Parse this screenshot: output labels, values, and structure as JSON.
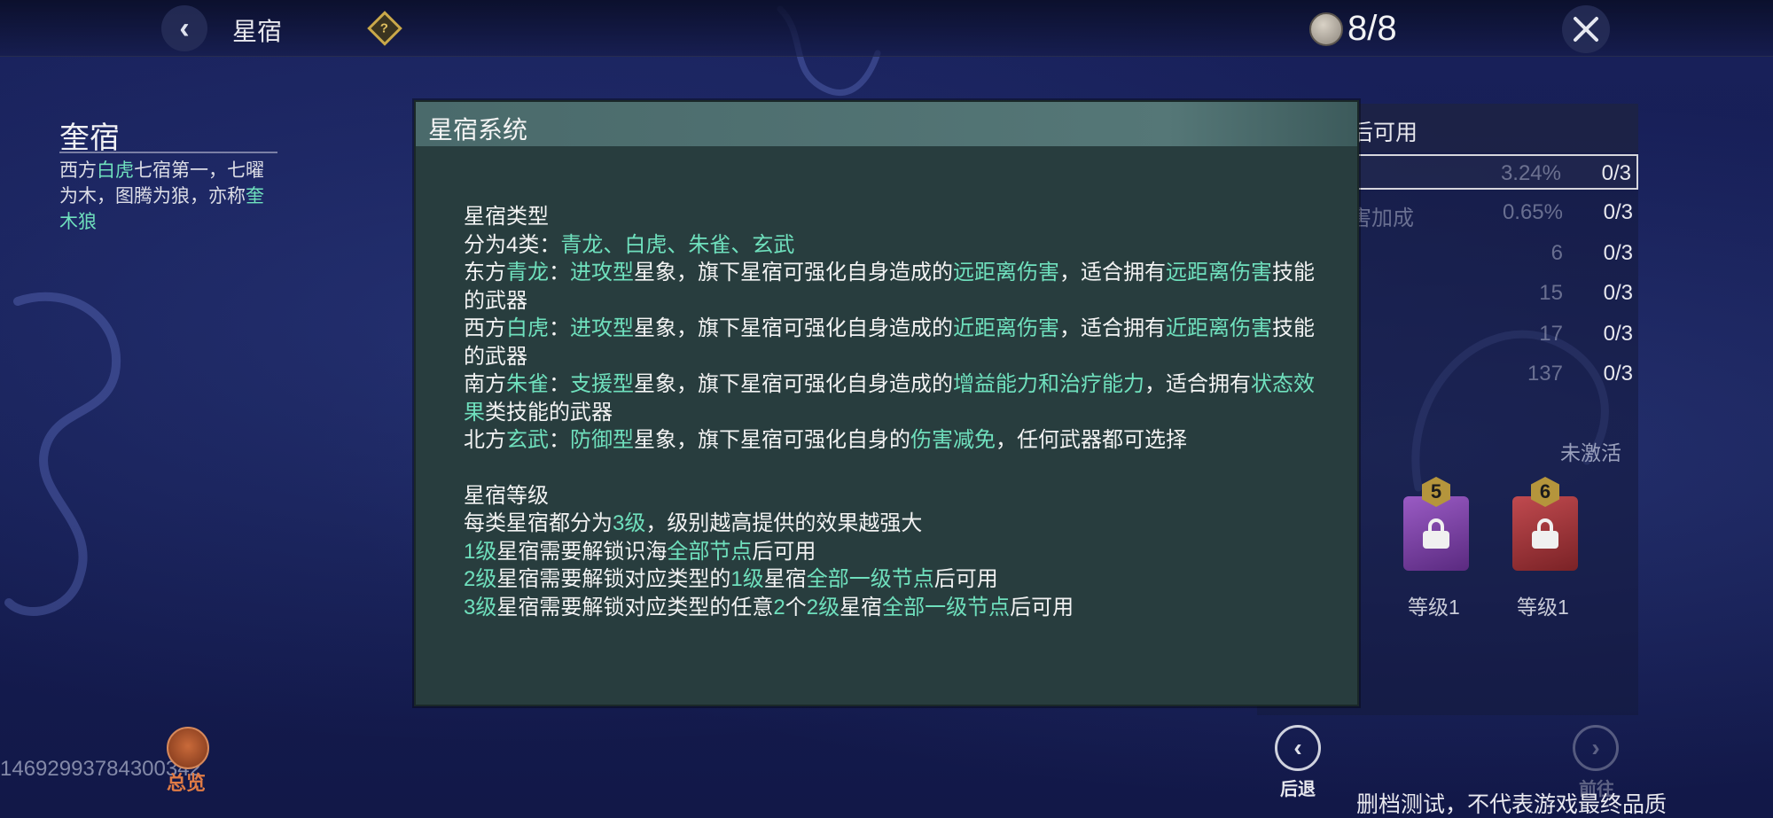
{
  "header": {
    "back_icon": "back-arrow-icon",
    "title": "星宿",
    "help_icon": "help-diamond-icon",
    "currency_icon": "star-token-icon",
    "currency_value": "8/8",
    "close_icon": "close-x-icon"
  },
  "info": {
    "name": "奎宿",
    "desc_1": "西方",
    "desc_hl_1": "白虎",
    "desc_2": "七宿第一，七曜为木，图腾为狼，亦称",
    "desc_hl_2": "奎木狼"
  },
  "footer": {
    "overview_label": "总览",
    "uid": "14692993784300342",
    "back_label": "后退",
    "forward_label": "前往",
    "note": "删档测试，不代表游戏最终品质"
  },
  "right_panel": {
    "header_text": "后可用",
    "rows": [
      {
        "label": "",
        "value": "3.24%",
        "count": "0/3"
      },
      {
        "label": "害加成",
        "value": "0.65%",
        "count": "0/3"
      },
      {
        "label": "",
        "value": "6",
        "count": "0/3"
      },
      {
        "label": "",
        "value": "15",
        "count": "0/3"
      },
      {
        "label": "",
        "value": "17",
        "count": "0/3"
      },
      {
        "label": "",
        "value": "137",
        "count": "0/3"
      }
    ],
    "inactive_label": "未激活",
    "gems": [
      {
        "badge": "5",
        "level": "等级1",
        "color": "#7a3fa0",
        "lock_icon": "lock-icon"
      },
      {
        "badge": "6",
        "level": "等级1",
        "color": "#a8363c",
        "lock_icon": "lock-icon"
      }
    ]
  },
  "modal": {
    "title": "星宿系统",
    "section1_title": "星宿类型",
    "l1": [
      "分为4类：",
      {
        "hl": "青龙、白虎、朱雀、玄武"
      }
    ],
    "l2": [
      "东方",
      {
        "hl": "青龙"
      },
      "：",
      {
        "hl": "进攻型"
      },
      "星象，旗下星宿可强化自身造成的",
      {
        "hl": "远距离伤害"
      },
      "，适合拥有",
      {
        "hl": "远距离伤害"
      },
      "技能的武器"
    ],
    "l3": [
      "西方",
      {
        "hl": "白虎"
      },
      "：",
      {
        "hl": "进攻型"
      },
      "星象，旗下星宿可强化自身造成的",
      {
        "hl": "近距离伤害"
      },
      "，适合拥有",
      {
        "hl": "近距离伤害"
      },
      "技能的武器"
    ],
    "l4": [
      "南方",
      {
        "hl": "朱雀"
      },
      "：",
      {
        "hl": "支援型"
      },
      "星象，旗下星宿可强化自身造成的",
      {
        "hl": "增益能力和治疗能力"
      },
      "，适合拥有",
      {
        "hl": "状态效果"
      },
      "类技能的武器"
    ],
    "l5": [
      "北方",
      {
        "hl": "玄武"
      },
      "：",
      {
        "hl": "防御型"
      },
      "星象，旗下星宿可强化自身的",
      {
        "hl": "伤害减免"
      },
      "，任何武器都可选择"
    ],
    "section2_title": "星宿等级",
    "l6": [
      "每类星宿都分为",
      {
        "hl": "3级"
      },
      "，级别越高提供的效果越强大"
    ],
    "l7": [
      {
        "hl": "1级"
      },
      "星宿需要解锁识海",
      {
        "hl": "全部节点"
      },
      "后可用"
    ],
    "l8": [
      {
        "hl": "2级"
      },
      "星宿需要解锁对应类型的",
      {
        "hl": "1级"
      },
      "星宿",
      {
        "hl": "全部一级节点"
      },
      "后可用"
    ],
    "l9": [
      {
        "hl": "3级"
      },
      "星宿需要解锁对应类型的任意",
      {
        "hl": "2"
      },
      "个",
      {
        "hl": "2级"
      },
      "星宿",
      {
        "hl": "全部一级节点"
      },
      "后可用"
    ]
  },
  "colors": {
    "highlight": "#6fe0bd",
    "modal_bg": "#283d3e",
    "accent_gold": "#b5953c"
  }
}
